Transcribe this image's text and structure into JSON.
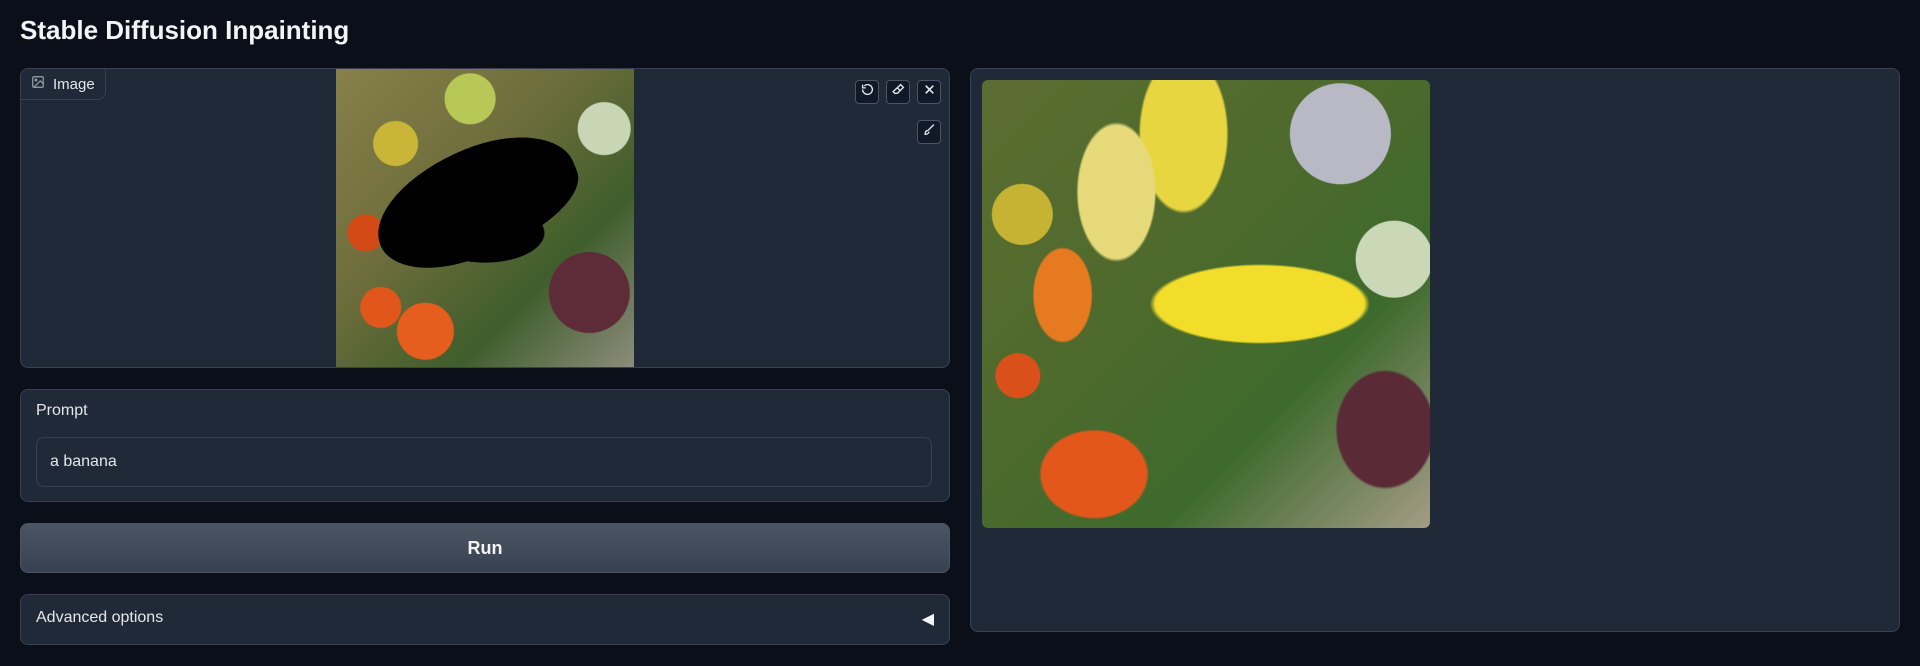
{
  "app": {
    "title": "Stable Diffusion Inpainting"
  },
  "input_image": {
    "label": "Image"
  },
  "prompt": {
    "label": "Prompt",
    "value": "a banana"
  },
  "run": {
    "label": "Run"
  },
  "advanced": {
    "label": "Advanced options",
    "arrow": "◀"
  },
  "icons": {
    "image_label": "image-icon",
    "undo": "undo-icon",
    "eraser": "eraser-icon",
    "close": "close-icon",
    "brush": "brush-icon"
  }
}
